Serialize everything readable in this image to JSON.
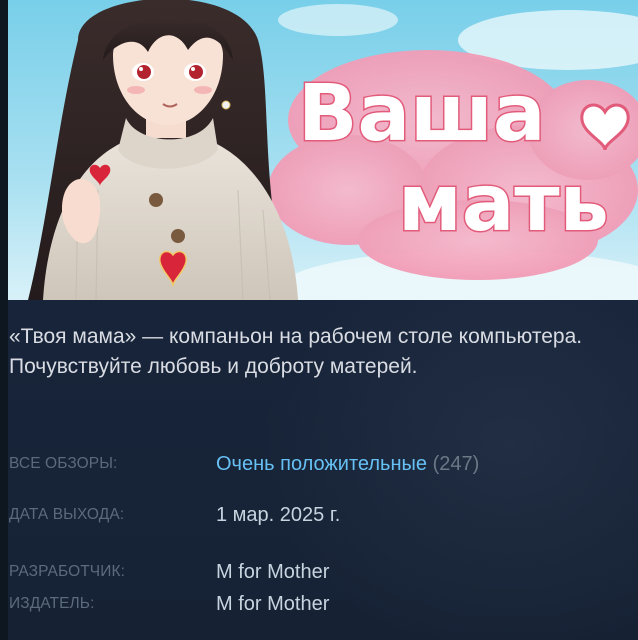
{
  "capsule": {
    "title_line1": "Ваша",
    "title_line2": "мать",
    "heart_icon": "heart-icon",
    "colors": {
      "sky": "#8fd6ee",
      "cloud": "#f4a9c0",
      "title_fill": "#ffffff",
      "title_outline": "#e25b7a"
    }
  },
  "description": "«Твоя мама» — компаньон на рабочем столе компьютера. Почувствуйте любовь и доброту матерей.",
  "reviews": {
    "label": "ВСЕ ОБЗОРЫ:",
    "summary": "Очень положительные",
    "count": "(247)"
  },
  "release": {
    "label": "ДАТА ВЫХОДА:",
    "date": "1 мар. 2025 г."
  },
  "developer": {
    "label": "РАЗРАБОТЧИК:",
    "name": "M for Mother"
  },
  "publisher": {
    "label": "ИЗДАТЕЛЬ:",
    "name": "M for Mother"
  },
  "colors": {
    "background": "#16202d",
    "link": "#66c0f4",
    "label": "#5b6a7c",
    "text": "#d9dde3"
  }
}
